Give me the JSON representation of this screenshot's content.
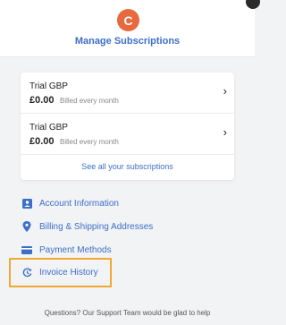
{
  "header": {
    "logo_letter": "C",
    "title": "Manage Subscriptions"
  },
  "subscriptions": [
    {
      "name": "Trial GBP",
      "price": "£0.00",
      "billing": "Billed every month"
    },
    {
      "name": "Trial GBP",
      "price": "£0.00",
      "billing": "Billed every month"
    }
  ],
  "see_all_label": "See all your subscriptions",
  "menu": [
    {
      "label": "Account Information",
      "icon": "account-icon"
    },
    {
      "label": "Billing & Shipping Addresses",
      "icon": "location-pin-icon"
    },
    {
      "label": "Payment Methods",
      "icon": "credit-card-icon"
    },
    {
      "label": "Invoice History",
      "icon": "invoice-history-icon"
    }
  ],
  "footer": {
    "support_text": "Questions? Our Support Team would be glad to help"
  },
  "colors": {
    "accent": "#3d6ec9",
    "logo": "#e8693c",
    "highlight": "#f0a830"
  }
}
